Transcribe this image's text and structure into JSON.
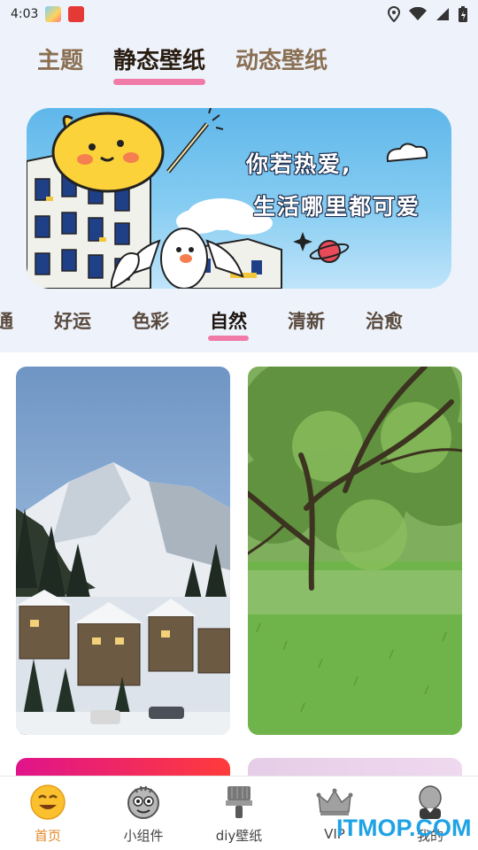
{
  "status_bar": {
    "time": "4:03"
  },
  "top_tabs": [
    {
      "label": "主题",
      "active": false
    },
    {
      "label": "静态壁纸",
      "active": true
    },
    {
      "label": "动态壁纸",
      "active": false
    }
  ],
  "banner": {
    "line1": "你若热爱,",
    "line2": "生活哪里都可爱"
  },
  "category_tabs": [
    {
      "label": "普通",
      "visible_fragment": "通",
      "active": false
    },
    {
      "label": "好运",
      "active": false
    },
    {
      "label": "色彩",
      "active": false
    },
    {
      "label": "自然",
      "active": true
    },
    {
      "label": "清新",
      "active": false
    },
    {
      "label": "治愈",
      "active": false
    }
  ],
  "wallpapers": [
    {
      "icon": "snowy-mountain-village-thumbnail"
    },
    {
      "icon": "green-tree-grass-thumbnail"
    },
    {
      "icon": "pink-red-gradient-thumbnail"
    },
    {
      "icon": "lavender-gradient-thumbnail"
    }
  ],
  "bottom_nav": {
    "items": [
      {
        "label": "首页",
        "icon": "smiley-icon",
        "active": true
      },
      {
        "label": "小组件",
        "icon": "widget-face-icon",
        "active": false
      },
      {
        "label": "diy壁纸",
        "icon": "paint-brush-icon",
        "active": false
      },
      {
        "label": "VIP",
        "icon": "crown-icon",
        "active": false
      },
      {
        "label": "我的",
        "icon": "profile-icon",
        "active": false
      }
    ]
  },
  "watermark": "ITMOP.COM",
  "colors": {
    "accent_pink": "#f07aa8",
    "active_nav": "#e38a2a",
    "watermark": "#1fa2e6"
  }
}
